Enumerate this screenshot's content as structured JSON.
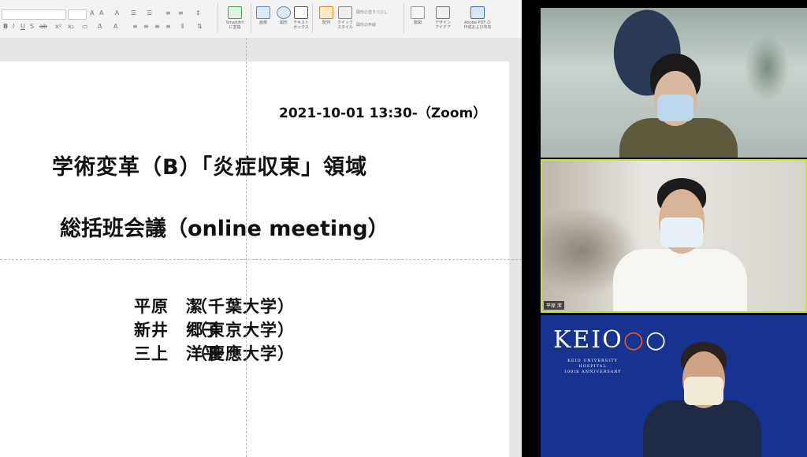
{
  "powerpoint": {
    "ribbon": {
      "groups": [
        {
          "label": "SmartArt\nに変換"
        },
        {
          "label": "画像"
        },
        {
          "label": "図形"
        },
        {
          "label": "テキスト\nボックス"
        },
        {
          "label": "配列"
        },
        {
          "label": "クイック\nスタイル"
        },
        {
          "label": "図形の塗りつぶし"
        },
        {
          "label": "図形の枠線"
        },
        {
          "label": "製図"
        },
        {
          "label": "デザイン\nアイデア"
        },
        {
          "label": "Adobe PDF の\n作成および共有"
        }
      ]
    },
    "slide": {
      "date_line": "2021-10-01 13:30-（Zoom）",
      "title": "学術変革（B）「炎症収束」領域",
      "subtitle": "総括班会議（online meeting）",
      "presenters": [
        {
          "name": "平原　潔",
          "affiliation": "（千葉大学）"
        },
        {
          "name": "新井　郷子",
          "affiliation": "（東京大学）"
        },
        {
          "name": "三上　洋平",
          "affiliation": "（慶應大学）"
        }
      ]
    }
  },
  "zoom": {
    "participants": [
      {
        "name": "",
        "active_speaker": false
      },
      {
        "name": "平原 潔",
        "active_speaker": true
      },
      {
        "name": "",
        "active_speaker": false
      }
    ],
    "keio_background": {
      "logo": "KEIO",
      "line1": "KEIO UNIVERSITY",
      "line2": "HOSPITAL",
      "line3": "100th ANNIVERSARY"
    },
    "active_speaker_color": "#c6e23c",
    "background_color": "#16338f"
  }
}
